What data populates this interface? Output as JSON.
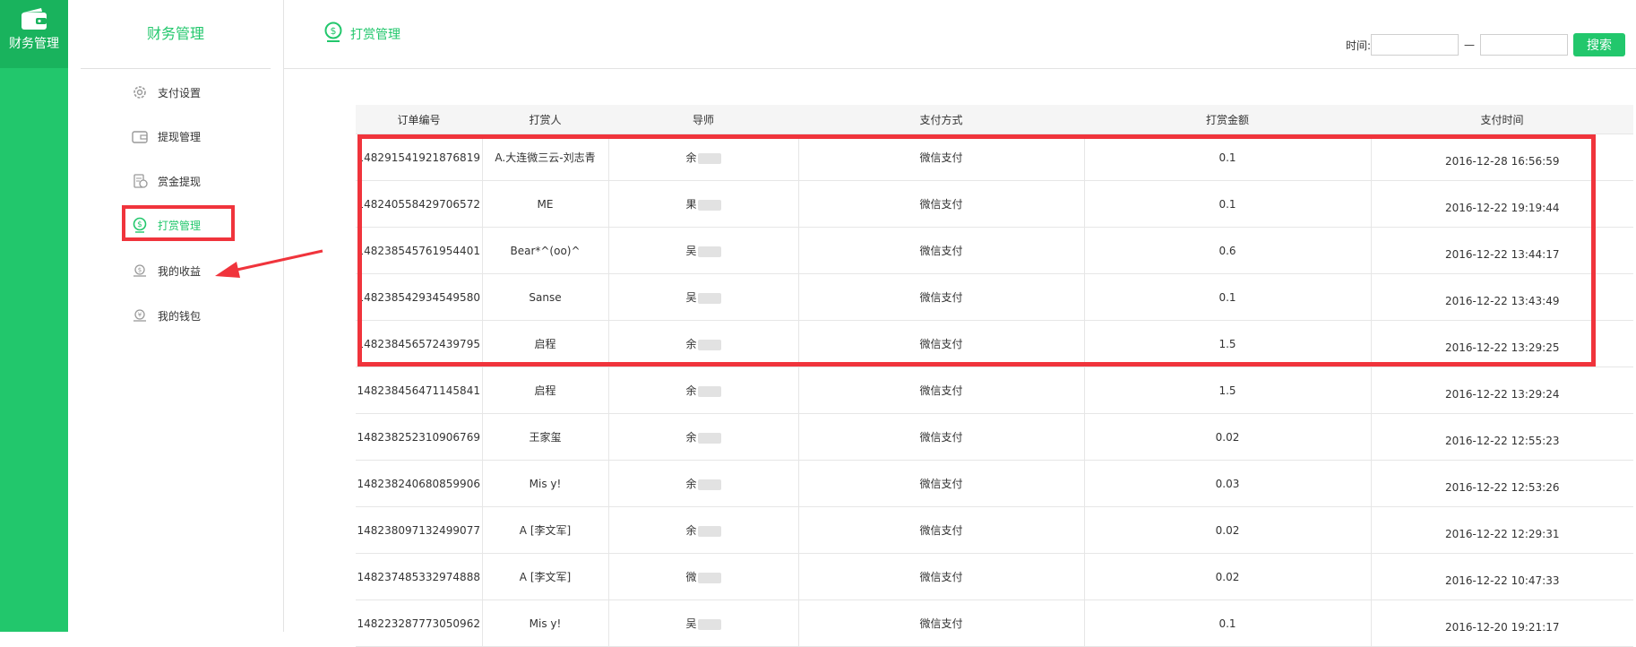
{
  "app": {
    "rail_label": "财务管理"
  },
  "sidebar": {
    "title": "财务管理",
    "items": [
      {
        "label": "支付设置",
        "icon": "gear-icon"
      },
      {
        "label": "提现管理",
        "icon": "wallet-icon"
      },
      {
        "label": "赏金提现",
        "icon": "coins-icon"
      },
      {
        "label": "打赏管理",
        "icon": "dollar-coin-icon",
        "active": true
      },
      {
        "label": "我的收益",
        "icon": "earnings-icon"
      },
      {
        "label": "我的钱包",
        "icon": "purse-icon"
      }
    ]
  },
  "header": {
    "title": "打赏管理",
    "filter_label": "时间:",
    "start_value": "",
    "end_value": "",
    "dash": "—",
    "search_label": "搜索"
  },
  "table": {
    "columns": [
      "订单编号",
      "打赏人",
      "导师",
      "支付方式",
      "打赏金额",
      "支付时间"
    ],
    "rows": [
      [
        "148291541921876819",
        "A.大连微三云-刘志青",
        "余",
        "微信支付",
        "0.1",
        "2016-12-28 16:56:59"
      ],
      [
        "148240558429706572",
        "ME",
        "果",
        "微信支付",
        "0.1",
        "2016-12-22 19:19:44"
      ],
      [
        "148238545761954401",
        "Bear*^(oo)^",
        "吴",
        "微信支付",
        "0.6",
        "2016-12-22 13:44:17"
      ],
      [
        "148238542934549580",
        "Sanse",
        "吴",
        "微信支付",
        "0.1",
        "2016-12-22 13:43:49"
      ],
      [
        "148238456572439795",
        "启程",
        "余",
        "微信支付",
        "1.5",
        "2016-12-22 13:29:25"
      ],
      [
        "148238456471145841",
        "启程",
        "余",
        "微信支付",
        "1.5",
        "2016-12-22 13:29:24"
      ],
      [
        "148238252310906769",
        "王家玺",
        "余",
        "微信支付",
        "0.02",
        "2016-12-22 12:55:23"
      ],
      [
        "148238240680859906",
        "Mis y!",
        "余",
        "微信支付",
        "0.03",
        "2016-12-22 12:53:26"
      ],
      [
        "148238097132499077",
        "A [李文军]",
        "余",
        "微信支付",
        "0.02",
        "2016-12-22 12:29:31"
      ],
      [
        "148237485332974888",
        "A [李文军]",
        "微",
        "微信支付",
        "0.02",
        "2016-12-22 10:47:33"
      ],
      [
        "148223287773050962",
        "Mis y!",
        "吴",
        "微信支付",
        "0.1",
        "2016-12-20 19:21:17"
      ]
    ]
  },
  "colors": {
    "accent": "#22c76c",
    "annotation": "#f0343c"
  }
}
